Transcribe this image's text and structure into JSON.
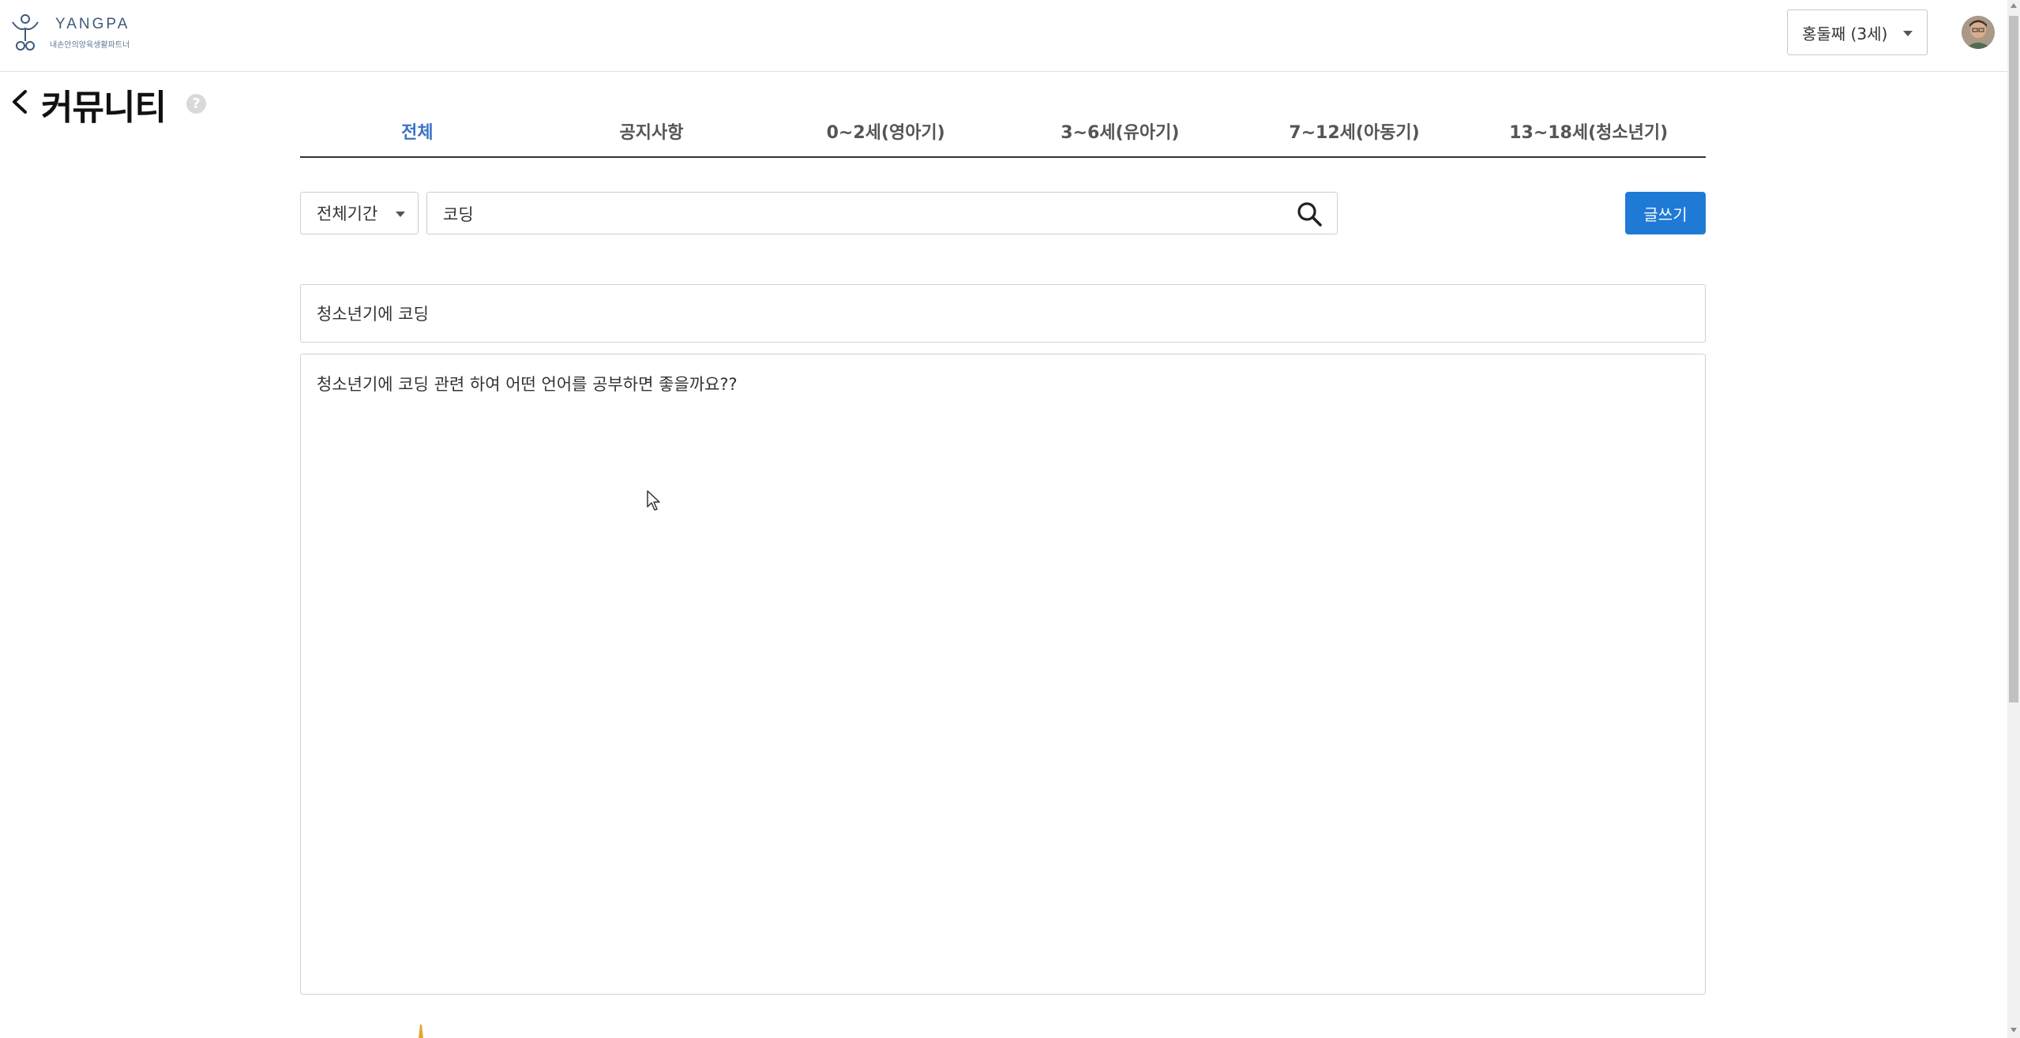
{
  "header": {
    "logo_text": "YANGPA",
    "logo_subtext": "내손안의양육생활파트너",
    "child_selector": "홍둘째 (3세)"
  },
  "page": {
    "title": "커뮤니티"
  },
  "tabs": [
    {
      "label": "전체",
      "active": true
    },
    {
      "label": "공지사항",
      "active": false
    },
    {
      "label": "0~2세(영아기)",
      "active": false
    },
    {
      "label": "3~6세(유아기)",
      "active": false
    },
    {
      "label": "7~12세(아동기)",
      "active": false
    },
    {
      "label": "13~18세(청소년기)",
      "active": false
    }
  ],
  "filter": {
    "period_label": "전체기간",
    "search_value": "코딩"
  },
  "write_button_label": "글쓰기",
  "post": {
    "title": "청소년기에 코딩",
    "content": "청소년기에 코딩 관련 하여 어떤 언어를 공부하면 좋을까요??"
  },
  "colors": {
    "accent": "#1f7ad6",
    "active_tab": "#3a73c8"
  }
}
